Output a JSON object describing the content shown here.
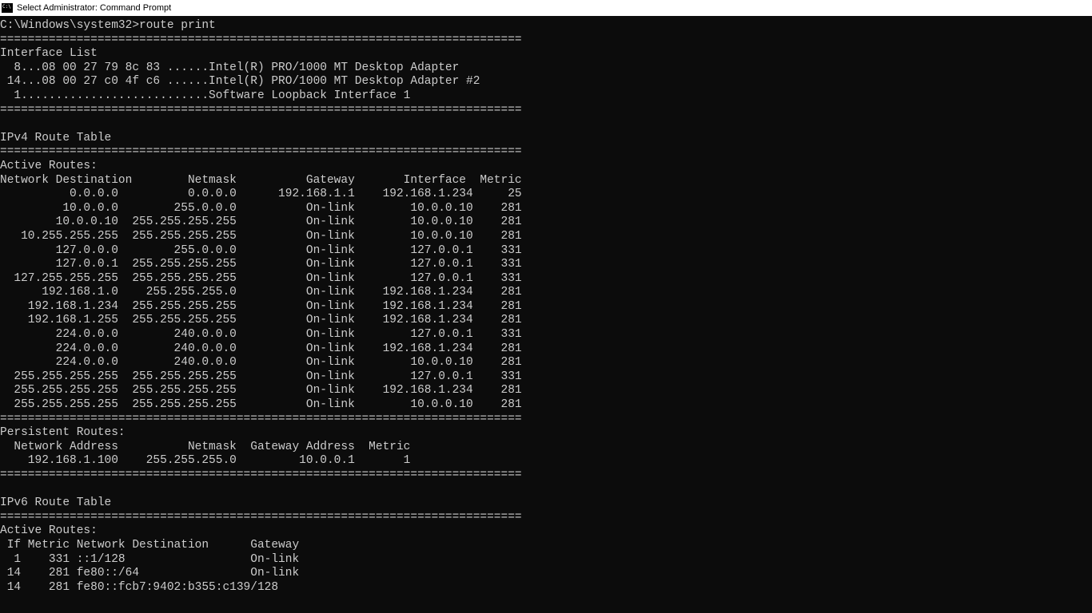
{
  "window": {
    "title": "Select Administrator: Command Prompt"
  },
  "prompt": {
    "path": "C:\\Windows\\system32>",
    "command": "route print"
  },
  "separator": "===========================================================================",
  "interface_list": {
    "header": "Interface List",
    "rows": [
      "  8...08 00 27 79 8c 83 ......Intel(R) PRO/1000 MT Desktop Adapter",
      " 14...08 00 27 c0 4f c6 ......Intel(R) PRO/1000 MT Desktop Adapter #2",
      "  1...........................Software Loopback Interface 1"
    ]
  },
  "ipv4": {
    "title": "IPv4 Route Table",
    "active_header": "Active Routes:",
    "columns": "Network Destination        Netmask          Gateway       Interface  Metric",
    "routes": [
      {
        "dest": "0.0.0.0",
        "mask": "0.0.0.0",
        "gw": "192.168.1.1",
        "iface": "192.168.1.234",
        "metric": "25"
      },
      {
        "dest": "10.0.0.0",
        "mask": "255.0.0.0",
        "gw": "On-link",
        "iface": "10.0.0.10",
        "metric": "281"
      },
      {
        "dest": "10.0.0.10",
        "mask": "255.255.255.255",
        "gw": "On-link",
        "iface": "10.0.0.10",
        "metric": "281"
      },
      {
        "dest": "10.255.255.255",
        "mask": "255.255.255.255",
        "gw": "On-link",
        "iface": "10.0.0.10",
        "metric": "281"
      },
      {
        "dest": "127.0.0.0",
        "mask": "255.0.0.0",
        "gw": "On-link",
        "iface": "127.0.0.1",
        "metric": "331"
      },
      {
        "dest": "127.0.0.1",
        "mask": "255.255.255.255",
        "gw": "On-link",
        "iface": "127.0.0.1",
        "metric": "331"
      },
      {
        "dest": "127.255.255.255",
        "mask": "255.255.255.255",
        "gw": "On-link",
        "iface": "127.0.0.1",
        "metric": "331"
      },
      {
        "dest": "192.168.1.0",
        "mask": "255.255.255.0",
        "gw": "On-link",
        "iface": "192.168.1.234",
        "metric": "281"
      },
      {
        "dest": "192.168.1.234",
        "mask": "255.255.255.255",
        "gw": "On-link",
        "iface": "192.168.1.234",
        "metric": "281"
      },
      {
        "dest": "192.168.1.255",
        "mask": "255.255.255.255",
        "gw": "On-link",
        "iface": "192.168.1.234",
        "metric": "281"
      },
      {
        "dest": "224.0.0.0",
        "mask": "240.0.0.0",
        "gw": "On-link",
        "iface": "127.0.0.1",
        "metric": "331"
      },
      {
        "dest": "224.0.0.0",
        "mask": "240.0.0.0",
        "gw": "On-link",
        "iface": "192.168.1.234",
        "metric": "281"
      },
      {
        "dest": "224.0.0.0",
        "mask": "240.0.0.0",
        "gw": "On-link",
        "iface": "10.0.0.10",
        "metric": "281"
      },
      {
        "dest": "255.255.255.255",
        "mask": "255.255.255.255",
        "gw": "On-link",
        "iface": "127.0.0.1",
        "metric": "331"
      },
      {
        "dest": "255.255.255.255",
        "mask": "255.255.255.255",
        "gw": "On-link",
        "iface": "192.168.1.234",
        "metric": "281"
      },
      {
        "dest": "255.255.255.255",
        "mask": "255.255.255.255",
        "gw": "On-link",
        "iface": "10.0.0.10",
        "metric": "281"
      }
    ],
    "persistent_header": "Persistent Routes:",
    "persistent_columns": "  Network Address          Netmask  Gateway Address  Metric",
    "persistent_routes": [
      {
        "addr": "192.168.1.100",
        "mask": "255.255.255.0",
        "gw": "10.0.0.1",
        "metric": "1"
      }
    ]
  },
  "ipv6": {
    "title": "IPv6 Route Table",
    "active_header": "Active Routes:",
    "columns": " If Metric Network Destination      Gateway",
    "routes": [
      {
        "if": "1",
        "metric": "331",
        "dest": "::1/128",
        "gw": "On-link"
      },
      {
        "if": "14",
        "metric": "281",
        "dest": "fe80::/64",
        "gw": "On-link"
      },
      {
        "if": "14",
        "metric": "281",
        "dest": "fe80::fcb7:9402:b355:c139/128",
        "gw": ""
      }
    ]
  }
}
